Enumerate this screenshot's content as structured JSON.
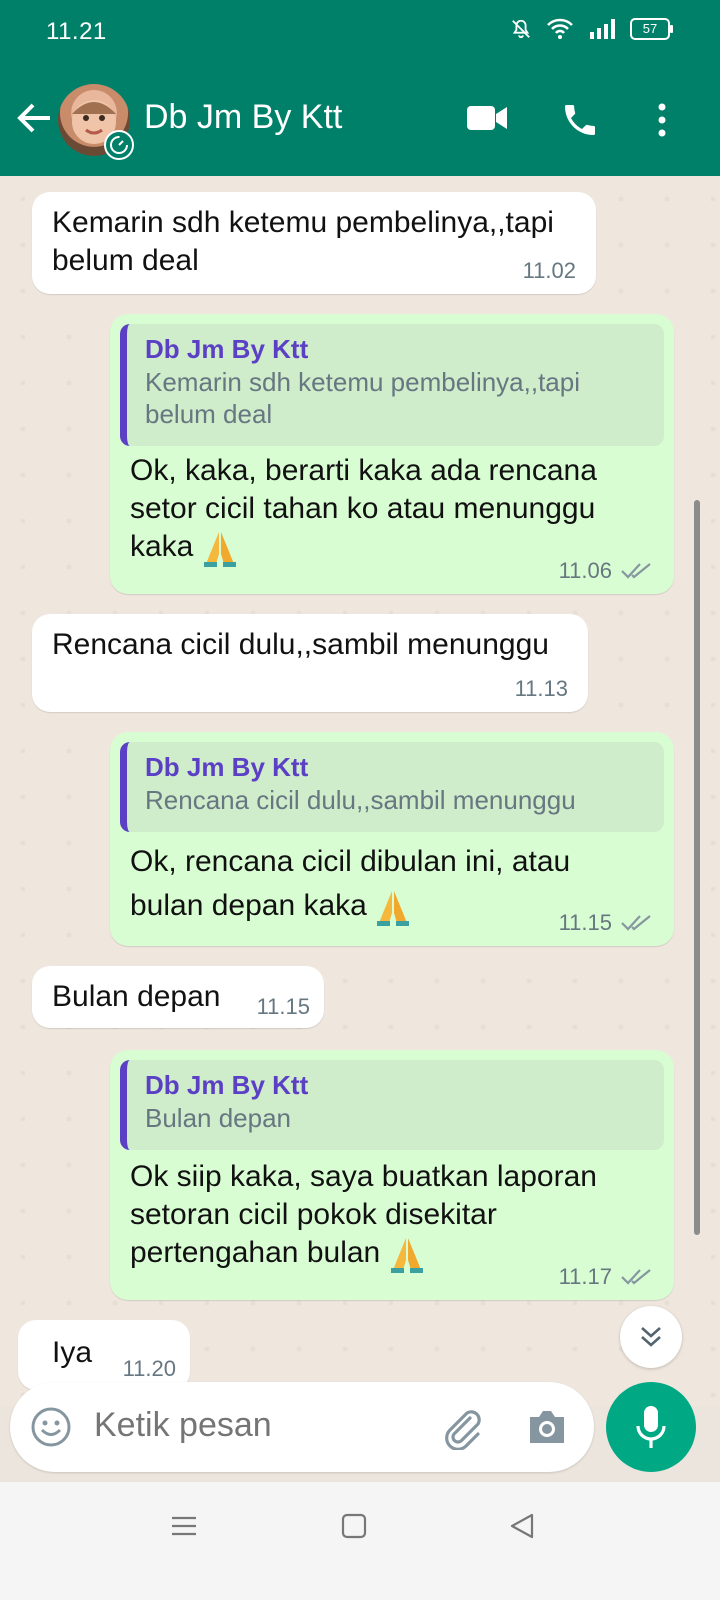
{
  "status_bar": {
    "time": "11.21",
    "battery": "57",
    "icons": [
      "mute-icon",
      "wifi-icon",
      "signal-icon",
      "battery-icon"
    ]
  },
  "header": {
    "contact_name": "Db Jm By Ktt",
    "icons": [
      "back-arrow-icon",
      "video-call-icon",
      "phone-icon",
      "more-menu-icon"
    ]
  },
  "messages": [
    {
      "direction": "incoming",
      "text": "Kemarin sdh ketemu pembelinya,,tapi belum deal",
      "time": "11.02"
    },
    {
      "direction": "outgoing",
      "quote_author": "Db Jm By Ktt",
      "quote_text": "Kemarin sdh ketemu pembelinya,,tapi belum deal",
      "text": "Ok, kaka, berarti kaka ada rencana setor cicil tahan ko atau menunggu kaka",
      "emoji": "folded-hands-emoji",
      "time": "11.06",
      "status": "read"
    },
    {
      "direction": "incoming",
      "text": "Rencana cicil dulu,,sambil menunggu",
      "time": "11.13"
    },
    {
      "direction": "outgoing",
      "quote_author": "Db Jm By Ktt",
      "quote_text": "Rencana cicil dulu,,sambil menunggu",
      "text": "Ok, rencana cicil  dibulan ini, atau bulan depan kaka",
      "emoji": "folded-hands-emoji",
      "time": "11.15",
      "status": "read"
    },
    {
      "direction": "incoming",
      "text": "Bulan depan",
      "time": "11.15"
    },
    {
      "direction": "outgoing",
      "quote_author": "Db Jm By Ktt",
      "quote_text": "Bulan depan",
      "text": "Ok siip kaka, saya buatkan laporan setoran cicil pokok disekitar pertengahan bulan",
      "emoji": "folded-hands-emoji",
      "time": "11.17",
      "status": "read"
    },
    {
      "direction": "incoming",
      "text": "Iya",
      "time": "11.20"
    }
  ],
  "composer": {
    "placeholder": "Ketik pesan",
    "icons": [
      "emoji-icon",
      "attach-icon",
      "camera-icon",
      "mic-icon"
    ]
  },
  "colors": {
    "header": "#008069",
    "outgoing_bubble": "#d9fdd3",
    "incoming_bubble": "#ffffff",
    "mic_button": "#00a884",
    "quote_accent": "#5b40c5"
  }
}
